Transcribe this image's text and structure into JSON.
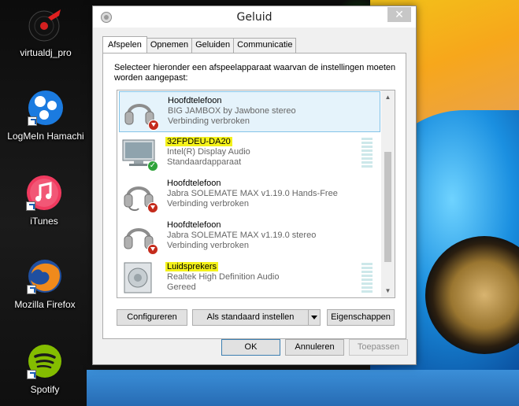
{
  "desktop": {
    "icons": [
      {
        "label": "virtualdj_pro",
        "icon": "virtualdj-icon"
      },
      {
        "label": "LogMeIn Hamachi",
        "icon": "hamachi-icon"
      },
      {
        "label": "iTunes",
        "icon": "itunes-icon"
      },
      {
        "label": "Mozilla Firefox",
        "icon": "firefox-icon"
      },
      {
        "label": "Spotify",
        "icon": "spotify-icon"
      }
    ]
  },
  "dialog": {
    "title": "Geluid",
    "close_label": "✕",
    "tabs": [
      {
        "label": "Afspelen",
        "active": true
      },
      {
        "label": "Opnemen",
        "active": false
      },
      {
        "label": "Geluiden",
        "active": false
      },
      {
        "label": "Communicatie",
        "active": false
      }
    ],
    "instruction": "Selecteer hieronder een afspeelapparaat waarvan de instellingen moeten worden aangepast:",
    "devices": [
      {
        "name": "Hoofdtelefoon",
        "description": "BIG JAMBOX by Jawbone stereo",
        "status": "Verbinding verbroken",
        "icon": "headphones-icon",
        "badge": "disconnected-icon",
        "selected": true,
        "highlighted": false,
        "level_meter": false
      },
      {
        "name": "32FPDEU-DA20",
        "description": "Intel(R) Display Audio",
        "status": "Standaardapparaat",
        "icon": "monitor-icon",
        "badge": "default-check-icon",
        "selected": false,
        "highlighted": true,
        "level_meter": true
      },
      {
        "name": "Hoofdtelefoon",
        "description": "Jabra SOLEMATE MAX v1.19.0 Hands-Free",
        "status": "Verbinding verbroken",
        "icon": "headset-icon",
        "badge": "disconnected-icon",
        "selected": false,
        "highlighted": false,
        "level_meter": false
      },
      {
        "name": "Hoofdtelefoon",
        "description": "Jabra SOLEMATE MAX v1.19.0 stereo",
        "status": "Verbinding verbroken",
        "icon": "headphones-icon",
        "badge": "disconnected-icon",
        "selected": false,
        "highlighted": false,
        "level_meter": false
      },
      {
        "name": "Luidsprekers",
        "description": "Realtek High Definition Audio",
        "status": "Gereed",
        "icon": "speaker-icon",
        "badge": "",
        "selected": false,
        "highlighted": true,
        "level_meter": true
      }
    ],
    "buttons": {
      "configure": "Configureren",
      "set_default": "Als standaard instellen",
      "properties": "Eigenschappen",
      "ok": "OK",
      "cancel": "Annuleren",
      "apply": "Toepassen"
    },
    "highlight_color": "#f4f21a",
    "selection_color": "#e5f3fb"
  }
}
